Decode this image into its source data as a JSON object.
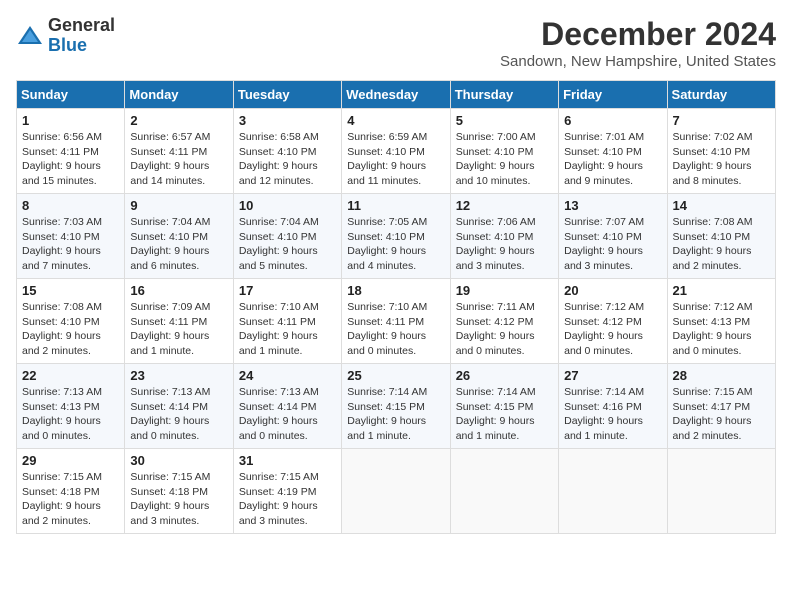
{
  "logo": {
    "general": "General",
    "blue": "Blue"
  },
  "title": "December 2024",
  "location": "Sandown, New Hampshire, United States",
  "days_of_week": [
    "Sunday",
    "Monday",
    "Tuesday",
    "Wednesday",
    "Thursday",
    "Friday",
    "Saturday"
  ],
  "weeks": [
    [
      {
        "day": "1",
        "sunrise": "Sunrise: 6:56 AM",
        "sunset": "Sunset: 4:11 PM",
        "daylight": "Daylight: 9 hours and 15 minutes."
      },
      {
        "day": "2",
        "sunrise": "Sunrise: 6:57 AM",
        "sunset": "Sunset: 4:11 PM",
        "daylight": "Daylight: 9 hours and 14 minutes."
      },
      {
        "day": "3",
        "sunrise": "Sunrise: 6:58 AM",
        "sunset": "Sunset: 4:10 PM",
        "daylight": "Daylight: 9 hours and 12 minutes."
      },
      {
        "day": "4",
        "sunrise": "Sunrise: 6:59 AM",
        "sunset": "Sunset: 4:10 PM",
        "daylight": "Daylight: 9 hours and 11 minutes."
      },
      {
        "day": "5",
        "sunrise": "Sunrise: 7:00 AM",
        "sunset": "Sunset: 4:10 PM",
        "daylight": "Daylight: 9 hours and 10 minutes."
      },
      {
        "day": "6",
        "sunrise": "Sunrise: 7:01 AM",
        "sunset": "Sunset: 4:10 PM",
        "daylight": "Daylight: 9 hours and 9 minutes."
      },
      {
        "day": "7",
        "sunrise": "Sunrise: 7:02 AM",
        "sunset": "Sunset: 4:10 PM",
        "daylight": "Daylight: 9 hours and 8 minutes."
      }
    ],
    [
      {
        "day": "8",
        "sunrise": "Sunrise: 7:03 AM",
        "sunset": "Sunset: 4:10 PM",
        "daylight": "Daylight: 9 hours and 7 minutes."
      },
      {
        "day": "9",
        "sunrise": "Sunrise: 7:04 AM",
        "sunset": "Sunset: 4:10 PM",
        "daylight": "Daylight: 9 hours and 6 minutes."
      },
      {
        "day": "10",
        "sunrise": "Sunrise: 7:04 AM",
        "sunset": "Sunset: 4:10 PM",
        "daylight": "Daylight: 9 hours and 5 minutes."
      },
      {
        "day": "11",
        "sunrise": "Sunrise: 7:05 AM",
        "sunset": "Sunset: 4:10 PM",
        "daylight": "Daylight: 9 hours and 4 minutes."
      },
      {
        "day": "12",
        "sunrise": "Sunrise: 7:06 AM",
        "sunset": "Sunset: 4:10 PM",
        "daylight": "Daylight: 9 hours and 3 minutes."
      },
      {
        "day": "13",
        "sunrise": "Sunrise: 7:07 AM",
        "sunset": "Sunset: 4:10 PM",
        "daylight": "Daylight: 9 hours and 3 minutes."
      },
      {
        "day": "14",
        "sunrise": "Sunrise: 7:08 AM",
        "sunset": "Sunset: 4:10 PM",
        "daylight": "Daylight: 9 hours and 2 minutes."
      }
    ],
    [
      {
        "day": "15",
        "sunrise": "Sunrise: 7:08 AM",
        "sunset": "Sunset: 4:10 PM",
        "daylight": "Daylight: 9 hours and 2 minutes."
      },
      {
        "day": "16",
        "sunrise": "Sunrise: 7:09 AM",
        "sunset": "Sunset: 4:11 PM",
        "daylight": "Daylight: 9 hours and 1 minute."
      },
      {
        "day": "17",
        "sunrise": "Sunrise: 7:10 AM",
        "sunset": "Sunset: 4:11 PM",
        "daylight": "Daylight: 9 hours and 1 minute."
      },
      {
        "day": "18",
        "sunrise": "Sunrise: 7:10 AM",
        "sunset": "Sunset: 4:11 PM",
        "daylight": "Daylight: 9 hours and 0 minutes."
      },
      {
        "day": "19",
        "sunrise": "Sunrise: 7:11 AM",
        "sunset": "Sunset: 4:12 PM",
        "daylight": "Daylight: 9 hours and 0 minutes."
      },
      {
        "day": "20",
        "sunrise": "Sunrise: 7:12 AM",
        "sunset": "Sunset: 4:12 PM",
        "daylight": "Daylight: 9 hours and 0 minutes."
      },
      {
        "day": "21",
        "sunrise": "Sunrise: 7:12 AM",
        "sunset": "Sunset: 4:13 PM",
        "daylight": "Daylight: 9 hours and 0 minutes."
      }
    ],
    [
      {
        "day": "22",
        "sunrise": "Sunrise: 7:13 AM",
        "sunset": "Sunset: 4:13 PM",
        "daylight": "Daylight: 9 hours and 0 minutes."
      },
      {
        "day": "23",
        "sunrise": "Sunrise: 7:13 AM",
        "sunset": "Sunset: 4:14 PM",
        "daylight": "Daylight: 9 hours and 0 minutes."
      },
      {
        "day": "24",
        "sunrise": "Sunrise: 7:13 AM",
        "sunset": "Sunset: 4:14 PM",
        "daylight": "Daylight: 9 hours and 0 minutes."
      },
      {
        "day": "25",
        "sunrise": "Sunrise: 7:14 AM",
        "sunset": "Sunset: 4:15 PM",
        "daylight": "Daylight: 9 hours and 1 minute."
      },
      {
        "day": "26",
        "sunrise": "Sunrise: 7:14 AM",
        "sunset": "Sunset: 4:15 PM",
        "daylight": "Daylight: 9 hours and 1 minute."
      },
      {
        "day": "27",
        "sunrise": "Sunrise: 7:14 AM",
        "sunset": "Sunset: 4:16 PM",
        "daylight": "Daylight: 9 hours and 1 minute."
      },
      {
        "day": "28",
        "sunrise": "Sunrise: 7:15 AM",
        "sunset": "Sunset: 4:17 PM",
        "daylight": "Daylight: 9 hours and 2 minutes."
      }
    ],
    [
      {
        "day": "29",
        "sunrise": "Sunrise: 7:15 AM",
        "sunset": "Sunset: 4:18 PM",
        "daylight": "Daylight: 9 hours and 2 minutes."
      },
      {
        "day": "30",
        "sunrise": "Sunrise: 7:15 AM",
        "sunset": "Sunset: 4:18 PM",
        "daylight": "Daylight: 9 hours and 3 minutes."
      },
      {
        "day": "31",
        "sunrise": "Sunrise: 7:15 AM",
        "sunset": "Sunset: 4:19 PM",
        "daylight": "Daylight: 9 hours and 3 minutes."
      },
      null,
      null,
      null,
      null
    ]
  ]
}
